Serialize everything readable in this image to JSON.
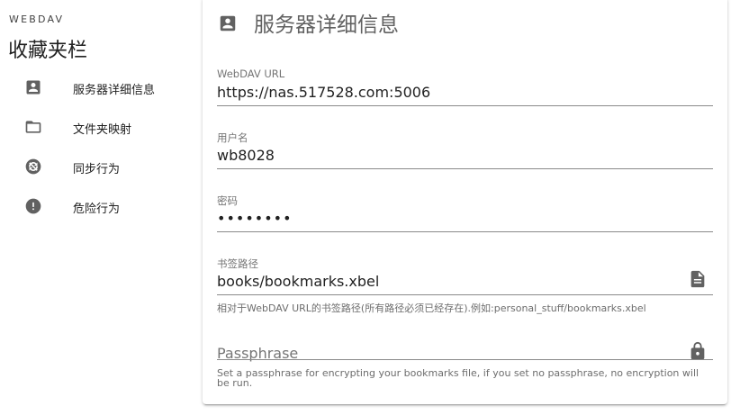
{
  "sidebar": {
    "brand": "WEBDAV",
    "title": "收藏夹栏",
    "items": [
      {
        "label": "服务器详细信息",
        "icon": "account-box-icon"
      },
      {
        "label": "文件夹映射",
        "icon": "folder-outline-icon"
      },
      {
        "label": "同步行为",
        "icon": "sync-off-icon"
      },
      {
        "label": "危险行为",
        "icon": "alert-circle-icon"
      }
    ]
  },
  "card": {
    "title": "服务器详细信息",
    "icon": "account-box-icon",
    "fields": {
      "url": {
        "label": "WebDAV URL",
        "value": "https://nas.517528.com:5006"
      },
      "username": {
        "label": "用户名",
        "value": "wb8028"
      },
      "password": {
        "label": "密码",
        "value": "••••••••"
      },
      "bookmark_path": {
        "label": "书签路径",
        "value": "books/bookmarks.xbel",
        "hint": "相对于WebDAV URL的书签路径(所有路径必须已经存在).例如:personal_stuff/bookmarks.xbel",
        "icon": "file-document-icon"
      },
      "passphrase": {
        "placeholder": "Passphrase",
        "value": "",
        "hint": "Set a passphrase for encrypting your bookmarks file, if you set no passphrase, no encryption will be run.",
        "icon": "lock-icon"
      }
    }
  },
  "colors": {
    "icon": "#616161",
    "text": "#212121",
    "muted": "#757575",
    "line": "#8a8a8a"
  }
}
